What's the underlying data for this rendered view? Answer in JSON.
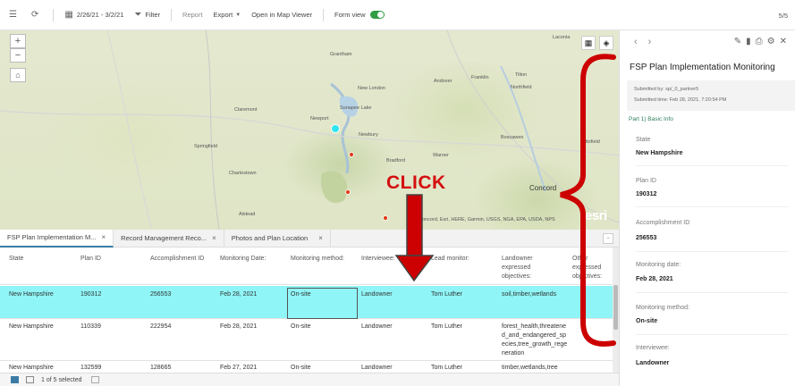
{
  "toolbar": {
    "date_range": "2/26/21 - 3/2/21",
    "filter": "Filter",
    "report": "Report",
    "export": "Export",
    "open_map_viewer": "Open in Map Viewer",
    "form_view": "Form view",
    "form_view_on": true,
    "page_count": "5/5"
  },
  "map": {
    "places": [
      "Laconia",
      "Grantham",
      "New London",
      "Andover",
      "Franklin",
      "Tilton",
      "Northfield",
      "Sunapee Lake",
      "Claremont",
      "Newport",
      "Springfield",
      "Newbury",
      "Boscawen",
      "Pittsfield",
      "Warner",
      "Bradford",
      "Charlestown",
      "Concord",
      "Alstead"
    ],
    "attribution": "Concord, Esri, HERE, Garmin, USGS, NGA, EPA, USDA, NPS",
    "esri_logo": "esri",
    "points": [
      {
        "color": "#2ee5f0",
        "selected": true
      },
      {
        "color": "#e23b1a"
      },
      {
        "color": "#e23b1a"
      },
      {
        "color": "#e23b1a"
      }
    ]
  },
  "tabs": [
    {
      "label": "FSP Plan Implementation M...",
      "active": true
    },
    {
      "label": "Record Management Reco...",
      "active": false
    },
    {
      "label": "Photos and Plan Location",
      "active": false
    }
  ],
  "table": {
    "columns": [
      "State",
      "Plan ID",
      "Accomplishment ID",
      "Monitoring Date:",
      "Monitoring method:",
      "Interviewee:",
      "Lead monitor:",
      "Landowner expressed objectives:",
      "Other expressed objectives:"
    ],
    "rows": [
      [
        "New Hampshire",
        "190312",
        "256553",
        "Feb 28, 2021",
        "On-site",
        "Landowner",
        "Tom Luther",
        "soil,timber,wetlands",
        ""
      ],
      [
        "New Hampshire",
        "110339",
        "222954",
        "Feb 28, 2021",
        "On-site",
        "Landowner",
        "Tom Luther",
        "forest_health,threatened_and_endangered_species,tree_growth_regeneration",
        ""
      ],
      [
        "New Hampshire",
        "132599",
        "128665",
        "Feb 27, 2021",
        "On-site",
        "Landowner",
        "Tom Luther",
        "timber,wetlands,tree",
        ""
      ]
    ]
  },
  "status": {
    "selection": "1 of 5 selected"
  },
  "panel": {
    "title": "FSP Plan Implementation Monitoring",
    "submitted_by": "Submitted by:   sp/_0_partner5",
    "submitted_time": "Submitted time: Feb 28, 2021, 7:20:54 PM",
    "part": "Part 1) Basic Info",
    "fields": [
      {
        "label": "State",
        "value": "New Hampshire"
      },
      {
        "label": "Plan ID",
        "value": "190312"
      },
      {
        "label": "Accomplishment ID",
        "value": "256553"
      },
      {
        "label": "Monitoring date:",
        "value": "Feb 28, 2021"
      },
      {
        "label": "Monitoring method:",
        "value": "On-site"
      },
      {
        "label": "Interviewee:",
        "value": "Landowner"
      }
    ]
  },
  "annotation": {
    "click_label": "CLICK",
    "color": "#d40f0f"
  }
}
